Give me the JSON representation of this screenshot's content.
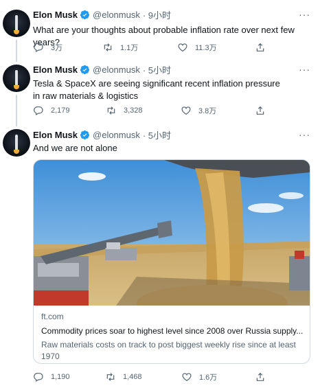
{
  "tweets": [
    {
      "name": "Elon Musk",
      "handle": "@elonmusk",
      "time": "· 9小时",
      "text": "What are your thoughts about probable inflation rate over next few years?",
      "replies": "3万",
      "retweets": "1.1万",
      "likes": "11.3万"
    },
    {
      "name": "Elon Musk",
      "handle": "@elonmusk",
      "time": "· 5小时",
      "text": "Tesla & SpaceX are seeing significant recent inflation pressure in raw materials & logistics",
      "replies": "2,179",
      "retweets": "3,328",
      "likes": "3.8万"
    },
    {
      "name": "Elon Musk",
      "handle": "@elonmusk",
      "time": "· 5小时",
      "text": "And we are not alone",
      "replies": "1,190",
      "retweets": "1,468",
      "likes": "1.6万"
    }
  ],
  "card": {
    "domain": "ft.com",
    "title": "Commodity prices soar to highest level since 2008 over Russia supply...",
    "description": "Raw materials costs on track to post biggest weekly rise since at least 1970"
  },
  "more_label": "···",
  "colors": {
    "verified": "#1d9bf0",
    "secondary_text": "#536471",
    "border": "#cfd9de"
  },
  "icons": {
    "reply": "reply-icon",
    "retweet": "retweet-icon",
    "like": "heart-icon",
    "share": "share-icon",
    "verified": "verified-badge-icon",
    "more": "more-icon"
  }
}
